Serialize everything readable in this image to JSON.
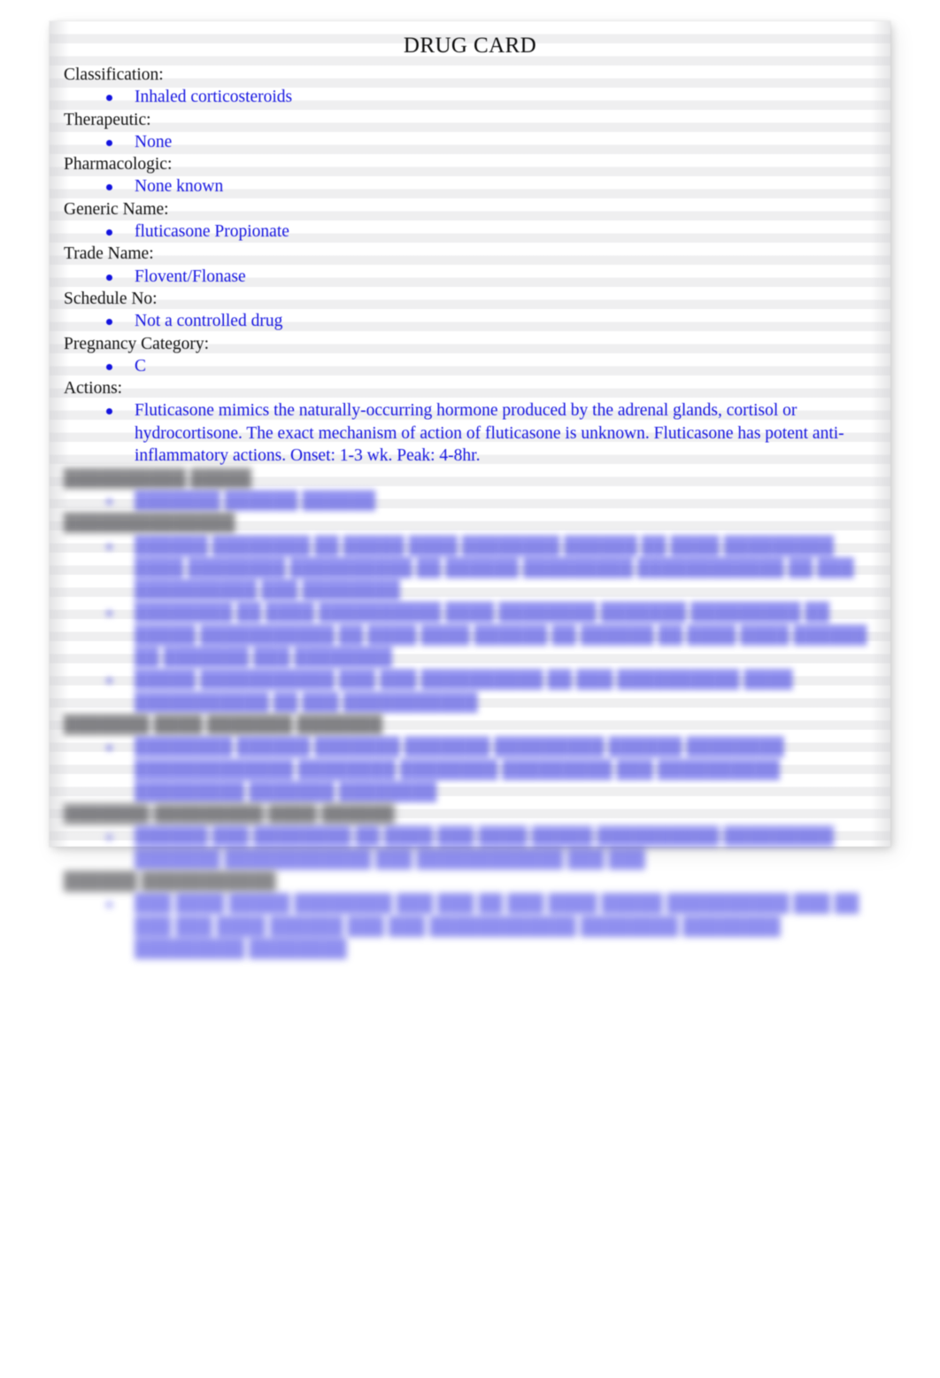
{
  "document": {
    "title": "DRUG CARD",
    "page_background": "#ffffff",
    "sheet_background": "#ffffff",
    "label_color": "#101010",
    "value_color": "#1414e0"
  },
  "sections": [
    {
      "label": "Classification:",
      "items": [
        "Inhaled corticosteroids"
      ],
      "legible": true
    },
    {
      "label": "Therapeutic:",
      "items": [
        "None"
      ],
      "legible": true
    },
    {
      "label": "Pharmacologic:",
      "items": [
        "None known"
      ],
      "legible": true
    },
    {
      "label": "Generic Name:",
      "items": [
        "fluticasone Propionate"
      ],
      "legible": true
    },
    {
      "label": "Trade Name:",
      "items": [
        "Flovent/Flonase"
      ],
      "legible": true
    },
    {
      "label": "Schedule No:",
      "items": [
        "Not a controlled drug"
      ],
      "legible": true
    },
    {
      "label": "Pregnancy Category:",
      "items": [
        "C"
      ],
      "legible": true
    },
    {
      "label": "Actions:",
      "items": [
        "Fluticasone mimics the naturally-occurring hormone produced by the adrenal glands, cortisol or hydrocortisone. The exact mechanism of action of fluticasone is unknown. Fluticasone has potent anti-inflammatory actions. Onset: 1-3 wk. Peak: 4-8hr."
      ],
      "legible": true,
      "paragraph": true
    },
    {
      "label": "██████████ █████",
      "items": [
        "███████ ██████ ██████"
      ],
      "legible": false
    },
    {
      "label": "██████████████",
      "items": [
        "██████ ████████ ██ █████ ████ ████████ ██████ ██ ████ █████████ ████ ████████ ██████████ ██ ██████ █████████ ████████████ ██ ███ ██████████ ███ ████████",
        "████████ ██ ████ ██████████ ████ ████████ ███████ █████████ ██ █████ ███████████ ██ ████ ████ ██████ ██ ██████ ██ ████ ████ ██████ ██ ███████ ███ ████████",
        "█████ ███████████ ███ ███ ██████████ ██ ███ ██████████ ████ ███████████ ██ ███ ███████████"
      ],
      "legible": false
    },
    {
      "label": "███████ ████ ███████ ███████",
      "items": [
        "████████ ██████ ███████ ███████ █████████ ██████ ████████ █████████████ ████████ ████████ █████████ ███ ██████████ █████████ ███████ ████████"
      ],
      "legible": false
    },
    {
      "label": "███████ █████████ ████ ██████",
      "items": [
        "██████ ███ ████████ ██ ████ ███ ████ █████ ██████████ █████████ ███████ ████████████ ███ ████████████ ███ ███"
      ],
      "legible": false
    },
    {
      "label": "██████ ███████████",
      "items": [
        "███ ████ █████ ████████ ███ ███ ██ ███ ████ █████ ██████████ ███ ██ ███ ███ ████ ██████ ███ ███ ████████████ ████████ ████████ █████████ ████████"
      ],
      "legible": false
    }
  ]
}
